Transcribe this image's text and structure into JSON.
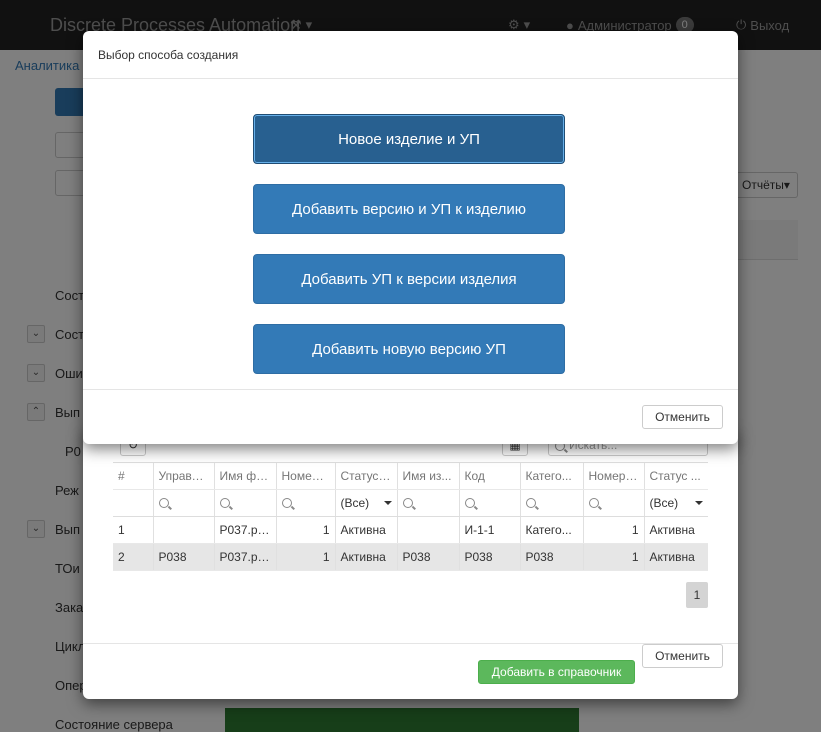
{
  "app": {
    "brand": "Discrete Processes Automation",
    "user": "Администратор",
    "notifications": "0",
    "logout": "Выход",
    "breadcrumb": "Аналитика"
  },
  "background": {
    "reports_label": "Отчёты",
    "sidebar": [
      "Состо",
      "Состо",
      "Оши",
      "Вып",
      "Р0",
      "Реж",
      "Вып",
      "ТОи",
      "Зака",
      "Цикл",
      "Опер",
      "Состояние сервера"
    ]
  },
  "dialog": {
    "title": "Выбор способа создания",
    "options": [
      "Новое изделие и УП",
      "Добавить версию и УП к изделию",
      "Добавить УП к версии изделия",
      "Добавить новую версию УП"
    ],
    "cancel": "Отменить"
  },
  "grid": {
    "search_placeholder": "Искать...",
    "columns": [
      "#",
      "Управл...",
      "Имя фа...",
      "Номер ...",
      "Статус ...",
      "Имя из...",
      "Код",
      "Катего...",
      "Номер ...",
      "Статус ..."
    ],
    "filters": [
      "",
      "",
      "",
      "",
      "(Все)",
      "",
      "",
      "",
      "",
      "(Все)"
    ],
    "rows": [
      [
        "1",
        "",
        "P037.pr...",
        "1",
        "Активна",
        "",
        "И-1-1",
        "Катего...",
        "1",
        "Активна"
      ],
      [
        "2",
        "P038",
        "P037.pr...",
        "1",
        "Активна",
        "P038",
        "P038",
        "P038",
        "1",
        "Активна"
      ]
    ],
    "page": "1",
    "add_button": "Добавить в справочник",
    "cancel_button": "Отменить"
  }
}
